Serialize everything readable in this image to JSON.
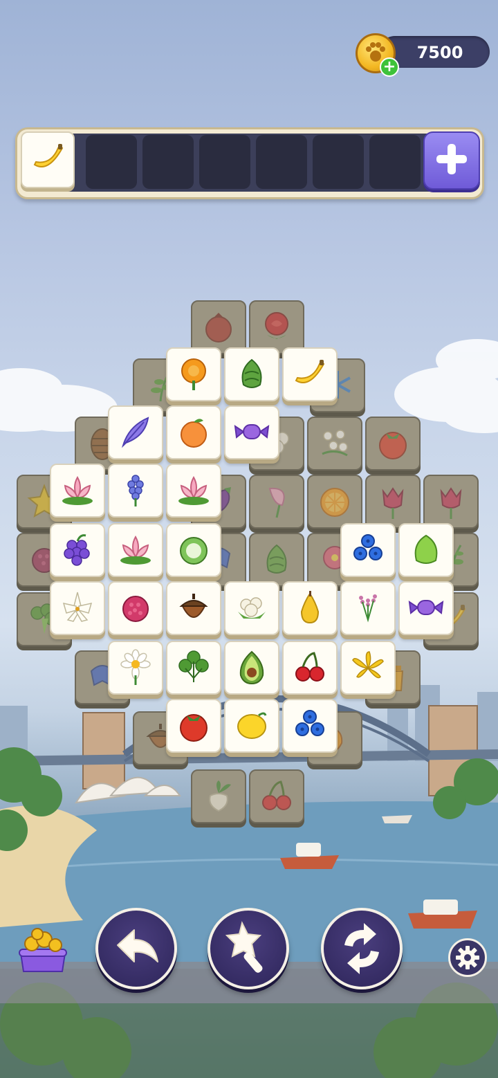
{
  "hud": {
    "coins": "7500",
    "coin_icon": "paw-coin-icon",
    "add_coins_icon": "plus-icon"
  },
  "tray": {
    "slots": 8,
    "filled": [
      "banana"
    ],
    "add_slot_icon": "plus-icon"
  },
  "board": {
    "top_layer": [
      [
        "marigold",
        "artichoke",
        "banana"
      ],
      [
        "feather",
        "peach",
        "candy"
      ],
      [
        "lotus",
        "hyacinth",
        "lotus"
      ],
      [
        "grapes",
        "lotus",
        "coconut",
        "blueberries",
        "chayote"
      ],
      [
        "lily",
        "raspberry",
        "acorn",
        "cauliflower",
        "pear",
        "lavender",
        "candy"
      ],
      [
        "daisy",
        "parsley",
        "avocado",
        "cherries",
        "ylang-ylang"
      ],
      [
        "tomato",
        "lemon",
        "blueberries"
      ],
      [
        "radish",
        "cherries"
      ]
    ],
    "lower_layer_visible": [
      "pomegranate",
      "rose",
      "fern",
      "snowflake",
      "pinecone",
      "cotton",
      "jasmine",
      "tomato",
      "starfruit",
      "eggplant",
      "calla-lily",
      "orange",
      "tulip",
      "tulip",
      "blackberry",
      "bellflower",
      "artichoke",
      "hibiscus",
      "broccoli",
      "banana",
      "bellflower",
      "acorn",
      "honey",
      "pepper"
    ]
  },
  "controls": {
    "undo_icon": "undo-arrow-icon",
    "magic_icon": "magic-wand-icon",
    "shuffle_icon": "shuffle-icon",
    "settings_icon": "gear-icon",
    "shop_icon": "coin-pot-icon"
  }
}
